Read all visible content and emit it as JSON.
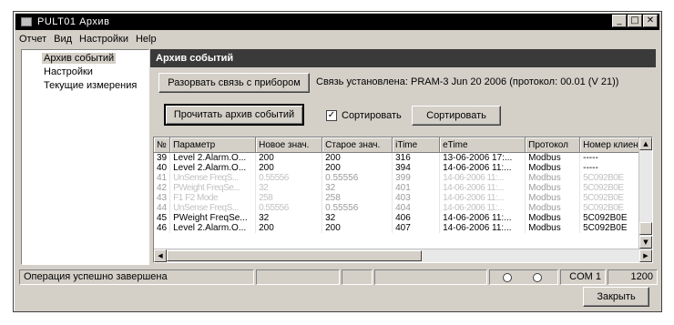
{
  "window": {
    "title": "PULT01 Архив",
    "controls": [
      "_",
      "□",
      "✕"
    ]
  },
  "menu": [
    "Отчет",
    "Вид",
    "Настройки",
    "Help"
  ],
  "sidebar": {
    "items": [
      {
        "label": "Архив событий"
      },
      {
        "label": "Настройки"
      },
      {
        "label": "Текущие измерения"
      }
    ]
  },
  "panel": {
    "title": "Архив событий",
    "disconnect_label": "Разорвать связь с прибором",
    "connection_status": "Связь установлена: PRAM-3 Jun 20 2006 (протокол: 00.01 (V 21))",
    "read_label": "Прочитать архив событий",
    "sort_check_label": "Сортировать",
    "sort_checked": true,
    "sort_button_label": "Сортировать"
  },
  "table": {
    "columns": [
      "№",
      "Параметр",
      "Новое знач.",
      "Старое знач.",
      "iTime",
      "eTime",
      "Протокол",
      "Номер клиента"
    ],
    "rows": [
      [
        "39",
        "Level 2.Alarm.O...",
        "200",
        "200",
        "316",
        "13-06-2006 17:...",
        "Modbus",
        "-----"
      ],
      [
        "40",
        "Level 2.Alarm.O...",
        "200",
        "200",
        "394",
        "14-06-2006 11:...",
        "Modbus",
        "-----"
      ],
      [
        "41",
        "UnSense FreqS...",
        "0.55556",
        "0.55556",
        "399",
        "14-06-2006 11:...",
        "Modbus",
        "5C092B0E"
      ],
      [
        "42",
        "PWeight FreqSe...",
        "32",
        "32",
        "401",
        "14-06-2006 11:...",
        "Modbus",
        "5C092B0E"
      ],
      [
        "43",
        "F1 F2 Mode",
        "258",
        "258",
        "403",
        "14-06-2006 11:...",
        "Modbus",
        "5C092B0E"
      ],
      [
        "44",
        "UnSense FreqS...",
        "0.55556",
        "0.55556",
        "404",
        "14-06-2006 11:...",
        "Modbus",
        "5C092B0E"
      ],
      [
        "45",
        "PWeight FreqSe...",
        "32",
        "32",
        "406",
        "14-06-2006 11:...",
        "Modbus",
        "5C092B0E"
      ],
      [
        "46",
        "Level 2.Alarm.O...",
        "200",
        "200",
        "407",
        "14-06-2006 11:...",
        "Modbus",
        "5C092B0E"
      ]
    ],
    "blurred_rows": [
      2,
      3,
      4,
      5
    ]
  },
  "statusbar": {
    "message": "Операция успешно завершена",
    "port": "COM 1",
    "baud": "1200"
  },
  "close_label": "Закрыть"
}
